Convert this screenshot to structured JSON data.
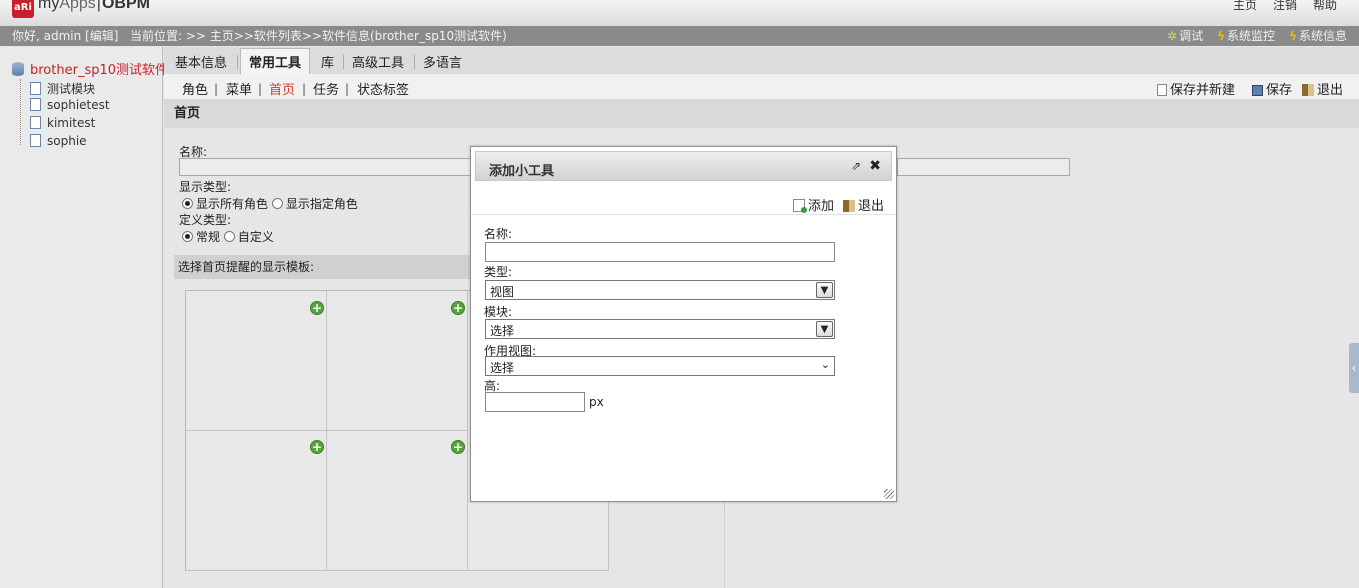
{
  "header": {
    "logo_mark": "aRi",
    "logo_my": "my",
    "logo_apps": "Apps",
    "logo_sep": "|",
    "logo_obpm": "OBPM",
    "links": [
      "主页",
      "注销",
      "帮助"
    ]
  },
  "infobar": {
    "greeting": "你好, admin [编辑]",
    "location": "当前位置: >> 主页>>软件列表>>软件信息(brother_sp10测试软件)",
    "debug": "调试",
    "monitor": "系统监控",
    "sysinfo": "系统信息"
  },
  "tree": {
    "root": "brother_sp10测试软件",
    "items": [
      "测试模块",
      "sophietest",
      "kimitest",
      "sophie"
    ]
  },
  "tabs": [
    "基本信息",
    "常用工具",
    "库",
    "高级工具",
    "多语言"
  ],
  "subtabs": [
    "角色",
    "菜单",
    "首页",
    "任务",
    "状态标签"
  ],
  "actions": {
    "save_new": "保存并新建",
    "save": "保存",
    "exit": "退出"
  },
  "form": {
    "section_title": "首页",
    "name_label": "名称:",
    "display_type_label": "显示类型:",
    "display_all": "显示所有角色",
    "display_specified": "显示指定角色",
    "define_type_label": "定义类型:",
    "type_normal": "常规",
    "type_custom": "自定义",
    "template_label": "选择首页提醒的显示模板:"
  },
  "dialog": {
    "title": "添加小工具",
    "add": "添加",
    "exit": "退出",
    "name_label": "名称:",
    "name_value": "",
    "type_label": "类型:",
    "type_value": "视图",
    "module_label": "模块:",
    "module_value": "选择",
    "view_label": "作用视图:",
    "view_value": "选择",
    "height_label": "高:",
    "height_value": "",
    "height_unit": "px"
  },
  "colors": {
    "accent_red": "#c8202a",
    "active_subtab": "#d43a2f",
    "add_green": "#56a53c"
  }
}
